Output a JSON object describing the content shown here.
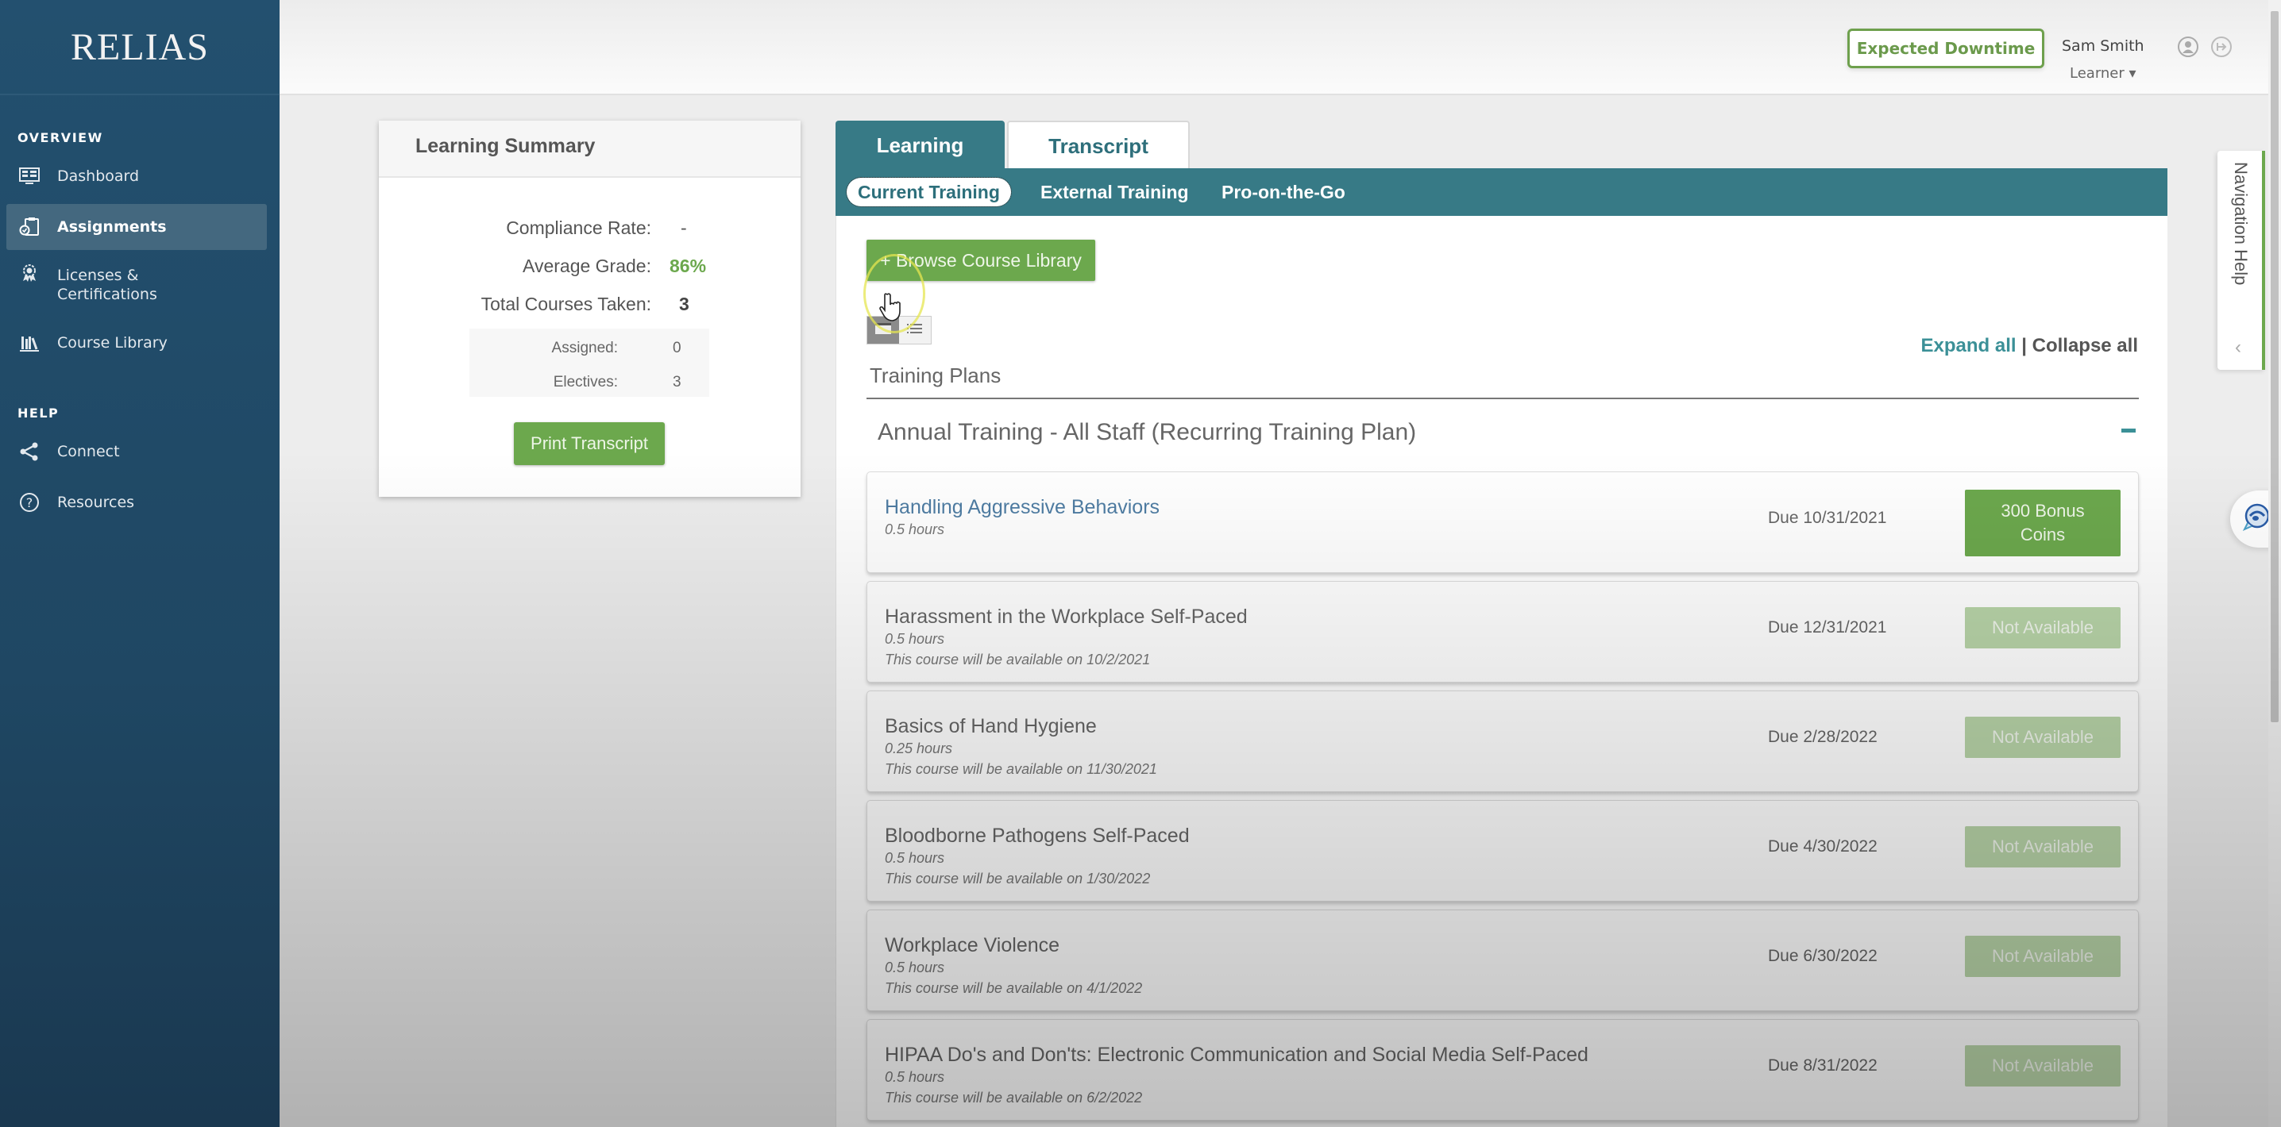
{
  "app": {
    "logo_text": "RELIAS"
  },
  "sidebar": {
    "sections": [
      {
        "title": "OVERVIEW"
      },
      {
        "title": "HELP"
      }
    ],
    "items": [
      {
        "label": "Dashboard",
        "icon": "dashboard-icon"
      },
      {
        "label": "Assignments",
        "icon": "assignments-icon",
        "active": true
      },
      {
        "label": "Licenses &",
        "label2": "Certifications",
        "icon": "award-icon"
      },
      {
        "label": "Course Library",
        "icon": "library-icon"
      },
      {
        "label": "Connect",
        "icon": "share-icon"
      },
      {
        "label": "Resources",
        "icon": "help-circle-icon"
      }
    ]
  },
  "header": {
    "downtime_label": "Expected Downtime",
    "user_name": "Sam Smith",
    "user_role": "Learner ▾",
    "icons": [
      "profile-icon",
      "logout-icon"
    ]
  },
  "summary": {
    "title": "Learning Summary",
    "stats": [
      {
        "label": "Compliance Rate:",
        "value": "-"
      },
      {
        "label": "Average Grade:",
        "value": "86%"
      },
      {
        "label": "Total Courses Taken:",
        "value": "3"
      }
    ],
    "sub_stats": [
      {
        "label": "Assigned:",
        "value": "0"
      },
      {
        "label": "Electives:",
        "value": "3"
      }
    ],
    "print_label": "Print Transcript"
  },
  "tabs": [
    {
      "label": "Learning",
      "active": true
    },
    {
      "label": "Transcript",
      "active": false
    }
  ],
  "subnav": [
    {
      "label": "Current Training",
      "active": true
    },
    {
      "label": "External Training",
      "active": false
    },
    {
      "label": "Pro-on-the-Go",
      "active": false
    }
  ],
  "content": {
    "browse_label": "+ Browse Course Library",
    "view_modes": [
      "card-view",
      "list-view"
    ],
    "plans_title": "Training Plans",
    "expand_all": "Expand all",
    "separator": "|",
    "collapse_all": "Collapse all",
    "plan_heading": "Annual Training - All Staff (Recurring Training Plan)",
    "courses": [
      {
        "title": "Handling Aggressive Behaviors",
        "hours": "0.5 hours",
        "availability": "",
        "due": "Due 10/31/2021",
        "action": "300 Bonus Coins",
        "available": true
      },
      {
        "title": "Harassment in the Workplace Self-Paced",
        "hours": "0.5 hours",
        "availability": "This course will be available on 10/2/2021",
        "due": "Due 12/31/2021",
        "action": "Not Available",
        "available": false
      },
      {
        "title": "Basics of Hand Hygiene",
        "hours": "0.25 hours",
        "availability": "This course will be available on 11/30/2021",
        "due": "Due 2/28/2022",
        "action": "Not Available",
        "available": false
      },
      {
        "title": "Bloodborne Pathogens Self-Paced",
        "hours": "0.5 hours",
        "availability": "This course will be available on 1/30/2022",
        "due": "Due 4/30/2022",
        "action": "Not Available",
        "available": false
      },
      {
        "title": "Workplace Violence",
        "hours": "0.5 hours",
        "availability": "This course will be available on 4/1/2022",
        "due": "Due 6/30/2022",
        "action": "Not Available",
        "available": false
      },
      {
        "title": "HIPAA Do's and Don'ts: Electronic Communication and Social Media Self-Paced",
        "hours": "0.5 hours",
        "availability": "This course will be available on 6/2/2022",
        "due": "Due 8/31/2022",
        "action": "Not Available",
        "available": false
      }
    ]
  },
  "widgets": {
    "nav_help_label": "Navigation Help",
    "nav_help_chevron": "‹"
  },
  "colors": {
    "sidebar": "#23506f",
    "teal": "#377a86",
    "green": "#6ca84d",
    "green_disabled": "#b8d4a8",
    "link_blue": "#4f7da3"
  }
}
